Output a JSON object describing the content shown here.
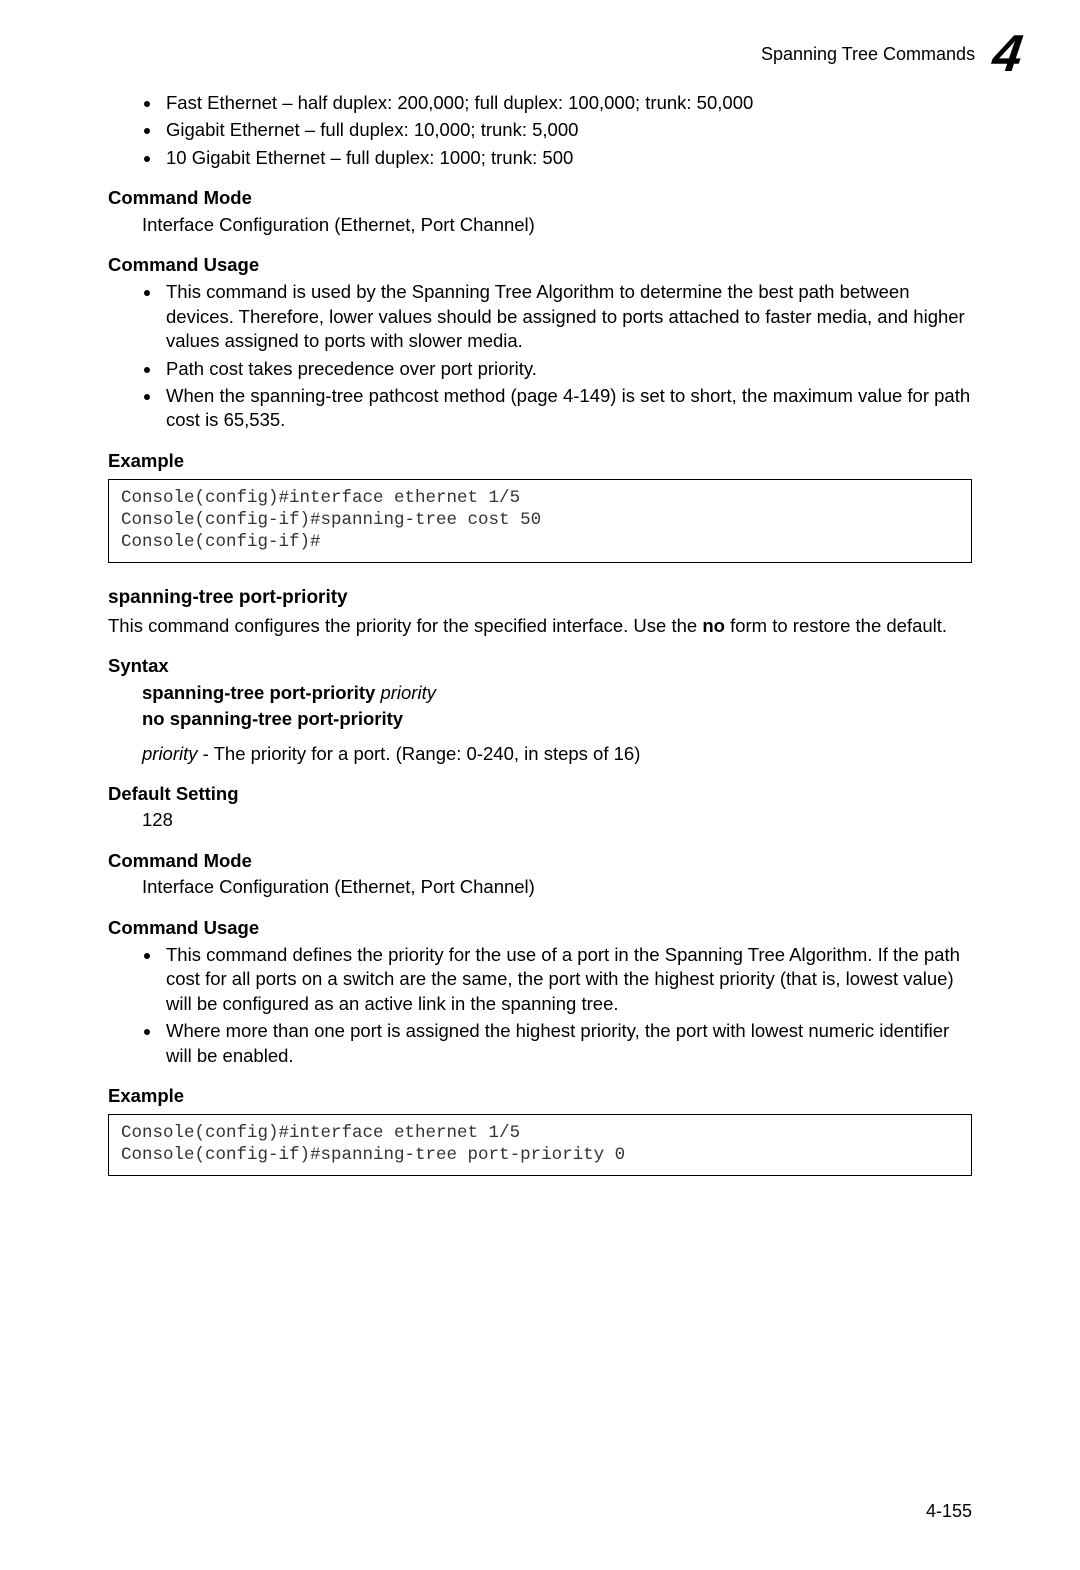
{
  "header": {
    "running_title": "Spanning Tree Commands",
    "chapter_number": "4"
  },
  "top_bullets": [
    "Fast Ethernet – half duplex: 200,000; full duplex: 100,000; trunk: 50,000",
    "Gigabit Ethernet – full duplex: 10,000; trunk: 5,000",
    "10 Gigabit Ethernet – full duplex: 1000; trunk: 500"
  ],
  "sect1": {
    "head_command_mode": "Command Mode",
    "command_mode_text": "Interface Configuration (Ethernet, Port Channel)",
    "head_command_usage": "Command Usage",
    "usage_bullets": [
      "This command is used by the Spanning Tree Algorithm to determine the best path between devices. Therefore, lower values should be assigned to ports attached to faster media, and higher values assigned to ports with slower media.",
      "Path cost takes precedence over port priority.",
      "When the spanning-tree pathcost method (page 4-149) is set to short, the maximum value for path cost is 65,535."
    ],
    "head_example": "Example",
    "example_code": "Console(config)#interface ethernet 1/5\nConsole(config-if)#spanning-tree cost 50\nConsole(config-if)#"
  },
  "sect2": {
    "cmd_title": "spanning-tree port-priority",
    "intro_pre": "This command configures the priority for the specified interface. Use the ",
    "intro_bold": "no",
    "intro_post": " form to restore the default.",
    "head_syntax": "Syntax",
    "syntax_line1_bold": "spanning-tree port-priority",
    "syntax_line1_ital": "priority",
    "syntax_line2_bold": "no spanning-tree port-priority",
    "priority_ital": "priority",
    "priority_desc": " - The priority for a port. (Range: 0-240, in steps of 16)",
    "head_default": "Default Setting",
    "default_value": "128",
    "head_command_mode": "Command Mode",
    "command_mode_text": "Interface Configuration (Ethernet, Port Channel)",
    "head_command_usage": "Command Usage",
    "usage_bullets": [
      "This command defines the priority for the use of a port in the Spanning Tree Algorithm. If the path cost for all ports on a switch are the same, the port with the highest priority (that is, lowest value) will be configured as an active link in the spanning tree.",
      "Where more than one port is assigned the highest priority, the port with lowest numeric identifier will be enabled."
    ],
    "head_example": "Example",
    "example_code": "Console(config)#interface ethernet 1/5\nConsole(config-if)#spanning-tree port-priority 0"
  },
  "footer": {
    "page_number": "4-155"
  }
}
